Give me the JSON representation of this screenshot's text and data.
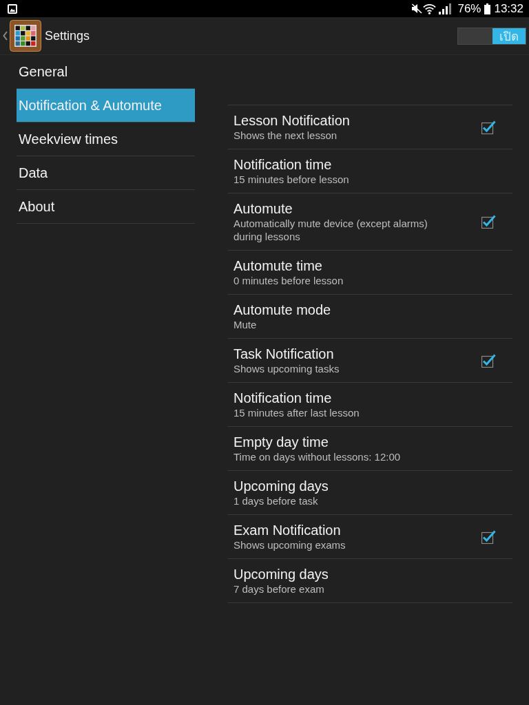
{
  "status_bar": {
    "battery": "76%",
    "time": "13:32"
  },
  "action_bar": {
    "title": "Settings",
    "switch": {
      "label": "เปิด",
      "on": true
    }
  },
  "sidebar": {
    "items": [
      {
        "label": "General",
        "selected": false
      },
      {
        "label": "Notification & Automute",
        "selected": true
      },
      {
        "label": "Weekview times",
        "selected": false
      },
      {
        "label": "Data",
        "selected": false
      },
      {
        "label": "About",
        "selected": false
      }
    ]
  },
  "preferences": [
    {
      "kind": "checkbox",
      "title": "Lesson Notification",
      "summary": "Shows the next lesson",
      "checked": true
    },
    {
      "kind": "text",
      "title": "Notification time",
      "summary": "15 minutes before lesson"
    },
    {
      "kind": "checkbox",
      "title": "Automute",
      "summary": "Automatically mute device (except alarms) during lessons",
      "checked": true
    },
    {
      "kind": "text",
      "title": "Automute time",
      "summary": "0 minutes before lesson"
    },
    {
      "kind": "text",
      "title": "Automute mode",
      "summary": "Mute"
    },
    {
      "kind": "checkbox",
      "title": "Task Notification",
      "summary": "Shows upcoming tasks",
      "checked": true
    },
    {
      "kind": "text",
      "title": "Notification time",
      "summary": "15 minutes after last lesson"
    },
    {
      "kind": "text",
      "title": "Empty day time",
      "summary": "Time on days without lessons: 12:00"
    },
    {
      "kind": "text",
      "title": "Upcoming days",
      "summary": "1 days before task"
    },
    {
      "kind": "checkbox",
      "title": "Exam Notification",
      "summary": "Shows upcoming exams",
      "checked": true
    },
    {
      "kind": "text",
      "title": "Upcoming days",
      "summary": "7 days before exam"
    }
  ]
}
